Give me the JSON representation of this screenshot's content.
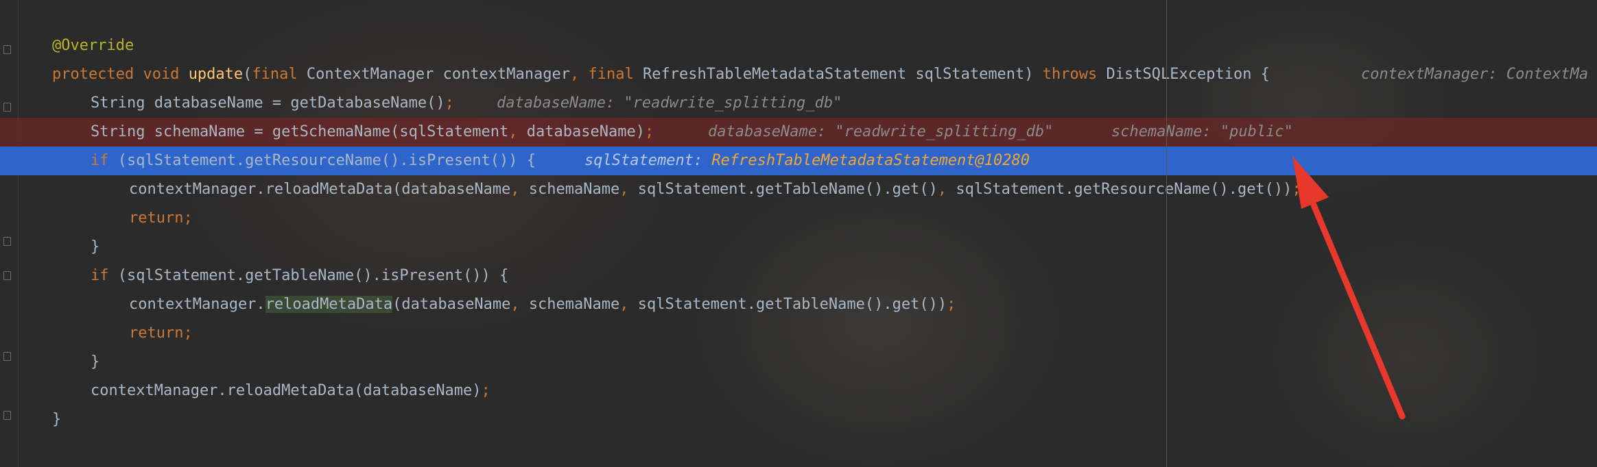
{
  "editor": {
    "lines": [
      {
        "a": "@Override"
      },
      {
        "kw1": "protected void ",
        "fn": "update",
        "p1": "(",
        "kw2": "final ",
        "p2": "ContextManager contextManager",
        "c1": ", ",
        "kw3": "final ",
        "p3": "RefreshTableMetadataStatement sqlStatement) ",
        "kw4": "throws ",
        "p4": "DistSQLException {",
        "hint": "contextManager: ContextMa"
      },
      {
        "p1": "String databaseName = getDatabaseName()",
        "s": ";",
        "hint": "databaseName: \"readwrite_splitting_db\""
      },
      {
        "p1": "String schemaName = getSchemaName(sqlStatement",
        "c1": ", ",
        "p2": "databaseName)",
        "s": ";",
        "hint1": "databaseName: \"readwrite_splitting_db\"",
        "hint2": "schemaName: \"public\""
      },
      {
        "kw": "if ",
        "p1": "(sqlStatement.getResourceName().isPresent()) {",
        "hint_label": "sqlStatement: ",
        "hint_obj": "RefreshTableMetadataStatement@10280"
      },
      {
        "p1": "contextManager.reloadMetaData(databaseName",
        "c1": ", ",
        "p2": "schemaName",
        "c2": ", ",
        "p3": "sqlStatement.getTableName().get()",
        "c3": ", ",
        "p4": "sqlStatement.getResourceName().get())",
        "s": ";"
      },
      {
        "kw": "return",
        "s": ";"
      },
      {
        "p1": "}"
      },
      {
        "kw": "if ",
        "p1": "(sqlStatement.getTableName().isPresent()) {"
      },
      {
        "p1": "contextManager.",
        "hl": "reloadMetaData",
        "p2": "(databaseName",
        "c1": ", ",
        "p3": "schemaName",
        "c2": ", ",
        "p4": "sqlStatement.getTableName().get())",
        "s": ";"
      },
      {
        "kw": "return",
        "s": ";"
      },
      {
        "p1": "}"
      },
      {
        "p1": "contextManager.reloadMetaData(databaseName)",
        "s": ";"
      },
      {
        "p1": "}"
      }
    ]
  },
  "colors": {
    "background": "#2b2b2b",
    "keyword": "#cc7832",
    "annotation": "#bbb529",
    "method_declaration": "#ffc66d",
    "plain": "#a9b7c6",
    "execution_line": "#2f65ca",
    "breakpoint_line": "#6e2626",
    "inlay_hint": "#8b8b8b",
    "inlay_object": "#f0a732",
    "arrow": "#e8382c"
  },
  "icons": [
    "fold-marker-icon",
    "red-arrow-annotation-icon"
  ]
}
